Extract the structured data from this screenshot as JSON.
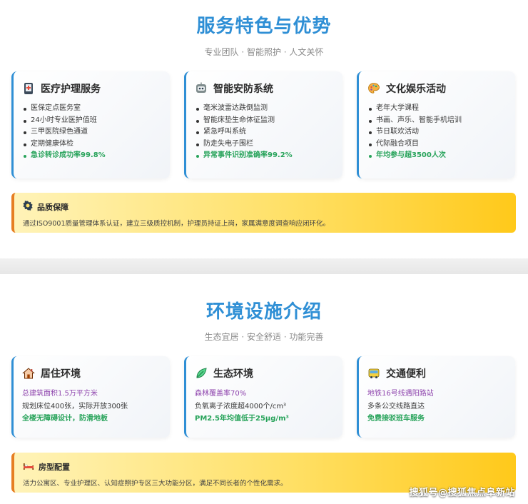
{
  "section1": {
    "title": "服务特色与优势",
    "subtitle": "专业团队 · 智能照护 · 人文关怀",
    "cards": [
      {
        "icon": "medical-phone-icon",
        "title": "医疗护理服务",
        "items": [
          "医保定点医务室",
          "24小时专业医护值班",
          "三甲医院绿色通道",
          "定期健康体检"
        ],
        "highlight": "急诊转诊成功率99.8%"
      },
      {
        "icon": "robot-icon",
        "title": "智能安防系统",
        "items": [
          "毫米波雷达跌倒监测",
          "智能床垫生命体征监测",
          "紧急呼叫系统",
          "防走失电子围栏"
        ],
        "highlight": "异常事件识别准确率99.2%"
      },
      {
        "icon": "palette-icon",
        "title": "文化娱乐活动",
        "items": [
          "老年大学课程",
          "书画、声乐、智能手机培训",
          "节日联欢活动",
          "代际融合项目"
        ],
        "highlight": "年均参与超3500人次"
      }
    ],
    "banner": {
      "icon": "badge-icon",
      "title": "品质保障",
      "text": "通过ISO9001质量管理体系认证，建立三级质控机制，护理员持证上岗，家属满意度调查响应闭环化。"
    }
  },
  "section2": {
    "title": "环境设施介绍",
    "subtitle": "生态宜居 · 安全舒适 · 功能完善",
    "cards": [
      {
        "icon": "house-icon",
        "title": "居住环境",
        "lines": [
          "总建筑面积1.5万平方米",
          "规划床位400张，实际开放300张",
          "全楼无障碍设计，防滑地板"
        ]
      },
      {
        "icon": "leaf-icon",
        "title": "生态环境",
        "lines": [
          "森林覆盖率70%",
          "负氧离子浓度超4000个/cm³",
          "PM2.5年均值低于25μg/m³"
        ]
      },
      {
        "icon": "bus-icon",
        "title": "交通便利",
        "lines": [
          "地铁16号线遇阳路站",
          "多条公交线路直达",
          "免费接驳班车服务"
        ]
      }
    ],
    "banner": {
      "icon": "bed-icon",
      "title": "房型配置",
      "text": "活力公寓区、专业护理区、认知症照护专区三大功能分区，满足不同长者的个性化需求。"
    }
  },
  "watermark": "搜狐号@搜狐焦点阜新站",
  "colors": {
    "title_blue": "#2f8fd5",
    "highlight_green": "#27a35a",
    "accent_purple": "#8e44ad",
    "banner_left_border": "#e67e22"
  }
}
